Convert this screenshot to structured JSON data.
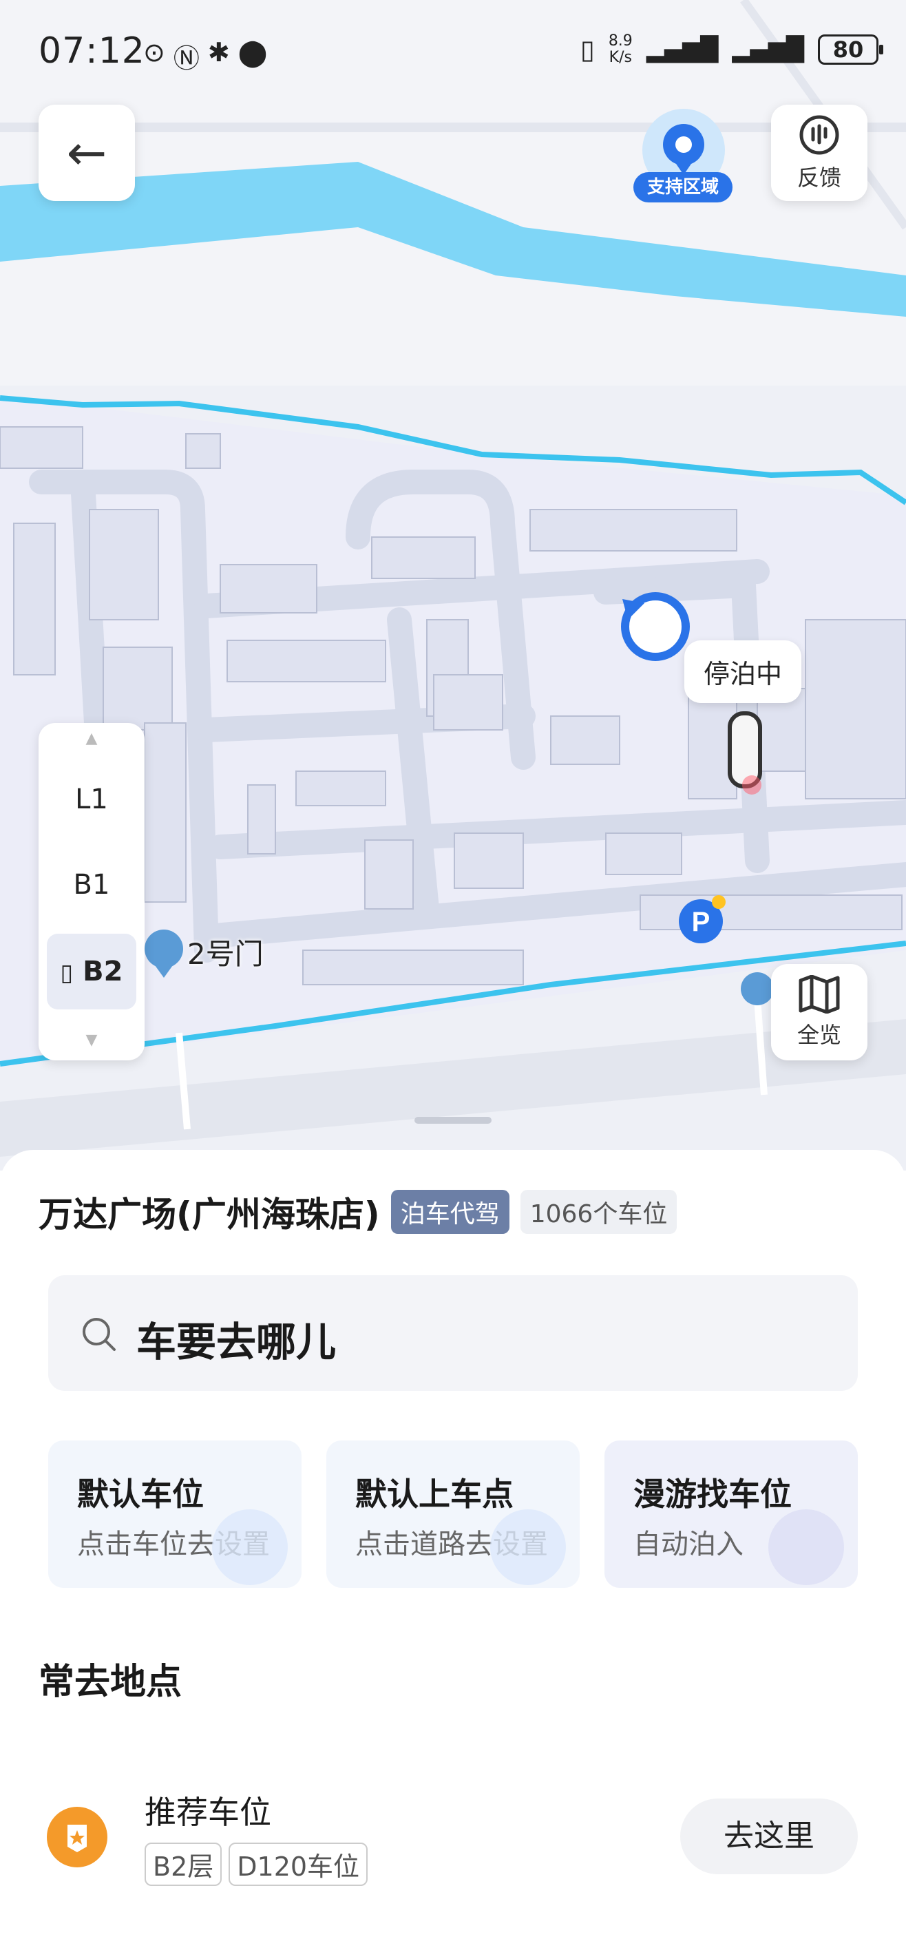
{
  "status_bar": {
    "time": "07:12",
    "net_speed_value": "8.9",
    "net_speed_unit": "K/s",
    "battery": "80"
  },
  "map": {
    "support_region_label": "支持区域",
    "feedback_label": "反馈",
    "overview_label": "全览",
    "parking_status_label": "停泊中",
    "gate_label": "2号门",
    "floors": [
      "L1",
      "B1",
      "B2"
    ],
    "active_floor": "B2",
    "colors": {
      "river": "#7fd6f7",
      "road_edge": "#3cc3ee",
      "location_blue": "#2a73e8",
      "parking_badge": "#2a73e8"
    }
  },
  "sheet": {
    "venue_name": "万达广场(广州海珠店)",
    "tag_valet": "泊车代驾",
    "tag_spots": "1066个车位",
    "search_placeholder": "车要去哪儿",
    "actions": [
      {
        "title": "默认车位",
        "subtitle": "点击车位去设置"
      },
      {
        "title": "默认上车点",
        "subtitle": "点击道路去设置"
      },
      {
        "title": "漫游找车位",
        "subtitle": "自动泊入"
      }
    ],
    "frequent_title": "常去地点",
    "recommended": {
      "title": "推荐车位",
      "tag_floor": "B2层",
      "tag_spot": "D120车位",
      "go_label": "去这里"
    }
  }
}
